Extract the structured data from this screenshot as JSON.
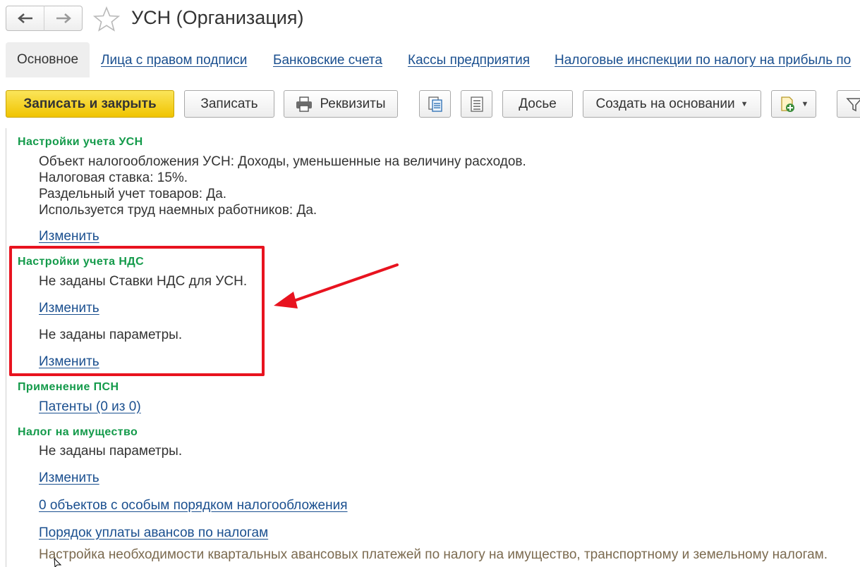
{
  "window": {
    "title": "УСН (Организация)"
  },
  "tabs": [
    {
      "label": "Основное"
    },
    {
      "label": "Лица с правом подписи"
    },
    {
      "label": "Банковские счета"
    },
    {
      "label": "Кассы предприятия"
    },
    {
      "label": "Налоговые инспекции по налогу на прибыль по"
    }
  ],
  "toolbar": {
    "save_close": "Записать и закрыть",
    "save": "Записать",
    "requisites": "Реквизиты",
    "dossier": "Досье",
    "create_based": "Создать на основании"
  },
  "usn": {
    "heading": "Настройки учета УСН",
    "lines": [
      "Объект налогообложения УСН: Доходы, уменьшенные на величину расходов.",
      "Налоговая ставка: 15%.",
      "Раздельный учет товаров: Да.",
      "Используется труд наемных работников: Да."
    ],
    "change_link": "Изменить"
  },
  "vat": {
    "heading": "Настройки учета НДС",
    "rates_text": "Не заданы Ставки НДС для УСН.",
    "change_link_1": "Изменить",
    "params_text": "Не заданы параметры.",
    "change_link_2": "Изменить"
  },
  "psn": {
    "heading": "Применение ПСН",
    "patents_link": "Патенты (0 из 0)"
  },
  "property_tax": {
    "heading": "Налог на имущество",
    "params_text": "Не заданы параметры.",
    "change_link": "Изменить",
    "objects_link": "0 объектов с особым порядком налогообложения",
    "advances_link": "Порядок уплаты авансов по налогам",
    "hint": "Настройка необходимости квартальных авансовых платежей по налогу на имущество, транспортному и земельному налогам."
  },
  "colors": {
    "section_heading": "#139a4a",
    "link": "#1a4f8f",
    "primary_button": "#f5d21b",
    "annotation": "#e8131f"
  },
  "icons": [
    "arrow-left-icon",
    "arrow-right-icon",
    "star-icon",
    "printer-icon",
    "document-list-icon",
    "list-icon",
    "new-document-icon",
    "filter-icon"
  ]
}
